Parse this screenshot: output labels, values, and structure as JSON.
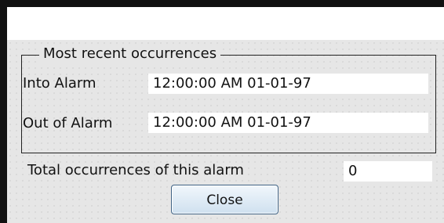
{
  "group": {
    "legend": "Most recent occurrences"
  },
  "into_alarm": {
    "label": "Into Alarm",
    "value": "12:00:00 AM 01-01-97"
  },
  "out_of_alarm": {
    "label": "Out of Alarm",
    "value": "12:00:00 AM 01-01-97"
  },
  "total": {
    "label": "Total occurrences of this alarm",
    "value": "0"
  },
  "buttons": {
    "close_label": "Close"
  }
}
